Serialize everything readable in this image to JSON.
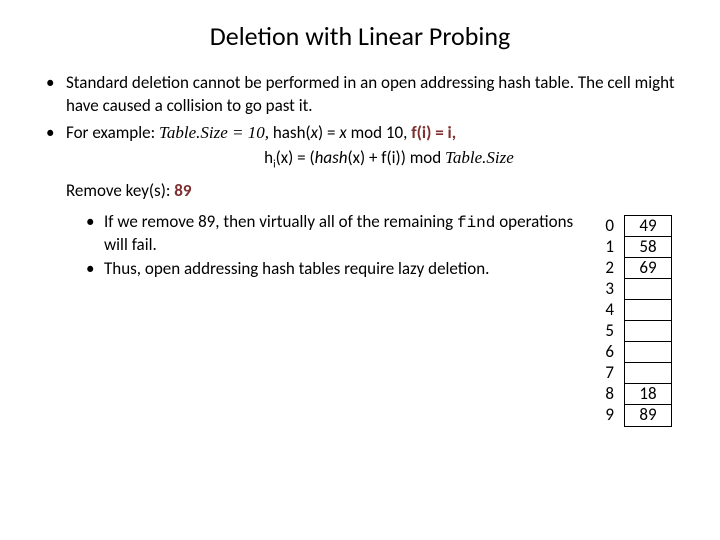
{
  "title": "Deletion with Linear Probing",
  "bullet1": "Standard deletion cannot be performed in an open addressing hash table. The cell might have caused a collision to go past it.",
  "bullet2_a": "For example: ",
  "bullet2_b": "Table.Size = 10,",
  "bullet2_c": "  hash(",
  "bullet2_d": "x",
  "bullet2_e": ") = ",
  "bullet2_f": "x",
  "bullet2_g": " mod 10, ",
  "bullet2_fi": "f(i) = i,",
  "formula_a": "h",
  "formula_sub": "i",
  "formula_b": "(x) = (",
  "formula_c": "hash",
  "formula_d": "(x) + f(i)) mod ",
  "formula_e": "Table.Size",
  "remove_label": "Remove key(s): ",
  "remove_val": "89",
  "sub1_a": "If we remove 89, then virtually all of the remaining ",
  "sub1_b": "find",
  "sub1_c": " operations will fail.",
  "sub2": "Thus, open addressing hash tables require lazy deletion.",
  "idx": [
    "0",
    "1",
    "2",
    "3",
    "4",
    "5",
    "6",
    "7",
    "8",
    "9"
  ],
  "cells": [
    "49",
    "58",
    "69",
    "",
    "",
    "",
    "",
    "",
    "18",
    "89"
  ]
}
